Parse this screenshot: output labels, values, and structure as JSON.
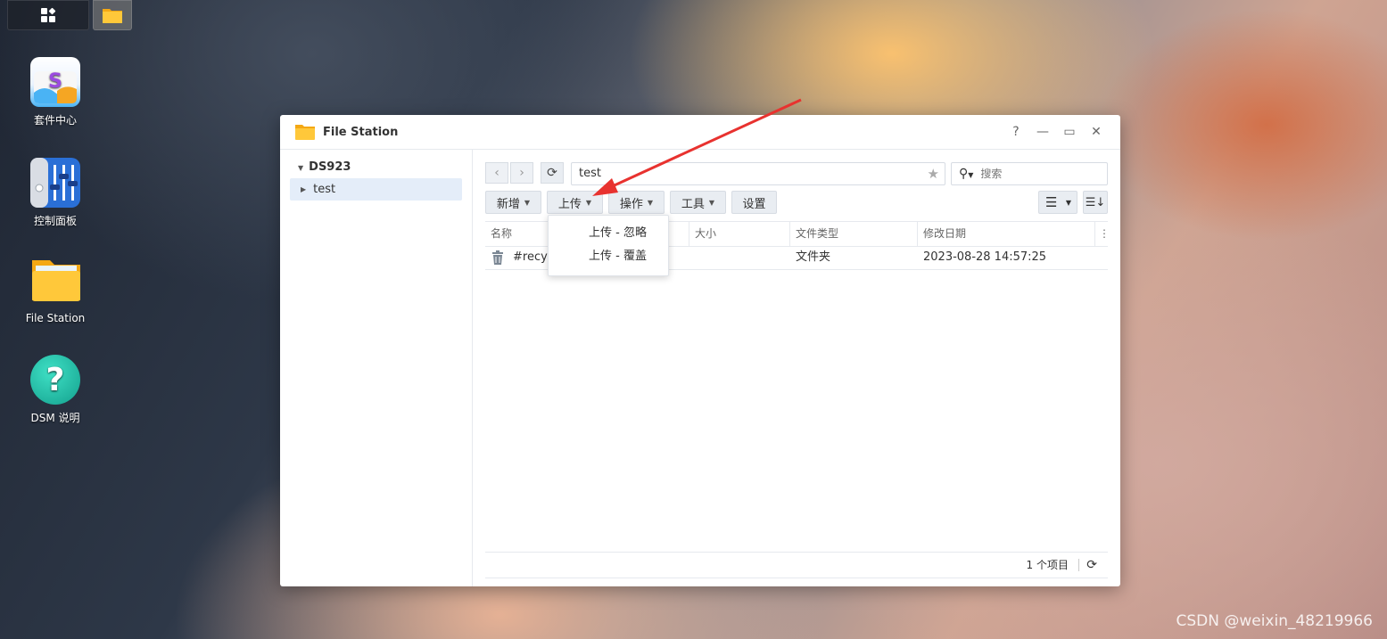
{
  "desktop": {
    "icons": [
      {
        "label": "套件中心"
      },
      {
        "label": "控制面板"
      },
      {
        "label": "File Station"
      },
      {
        "label": "DSM 说明"
      }
    ],
    "watermark": "CSDN @weixin_48219966"
  },
  "window": {
    "title": "File Station",
    "controls": {
      "help": "?",
      "minimize": "—",
      "maximize": "▭",
      "close": "✕"
    },
    "sidebar": {
      "root": "DS923",
      "items": [
        {
          "label": "test"
        }
      ]
    },
    "toolbar": {
      "path": "test",
      "search_placeholder": "搜索",
      "buttons": {
        "new": "新增",
        "upload": "上传",
        "action": "操作",
        "tools": "工具",
        "settings": "设置"
      }
    },
    "upload_menu": {
      "items": [
        "上传 - 忽略",
        "上传 - 覆盖"
      ]
    },
    "table": {
      "columns": [
        "名称",
        "大小",
        "文件类型",
        "修改日期"
      ],
      "rows": [
        {
          "name": "#recyc",
          "size": "",
          "type": "文件夹",
          "modified": "2023-08-28 14:57:25"
        }
      ]
    },
    "footer": {
      "count": "1 个项目"
    }
  },
  "colors": {
    "accent_arrow": "#e8322f",
    "selected_row": "#e4edf9"
  }
}
